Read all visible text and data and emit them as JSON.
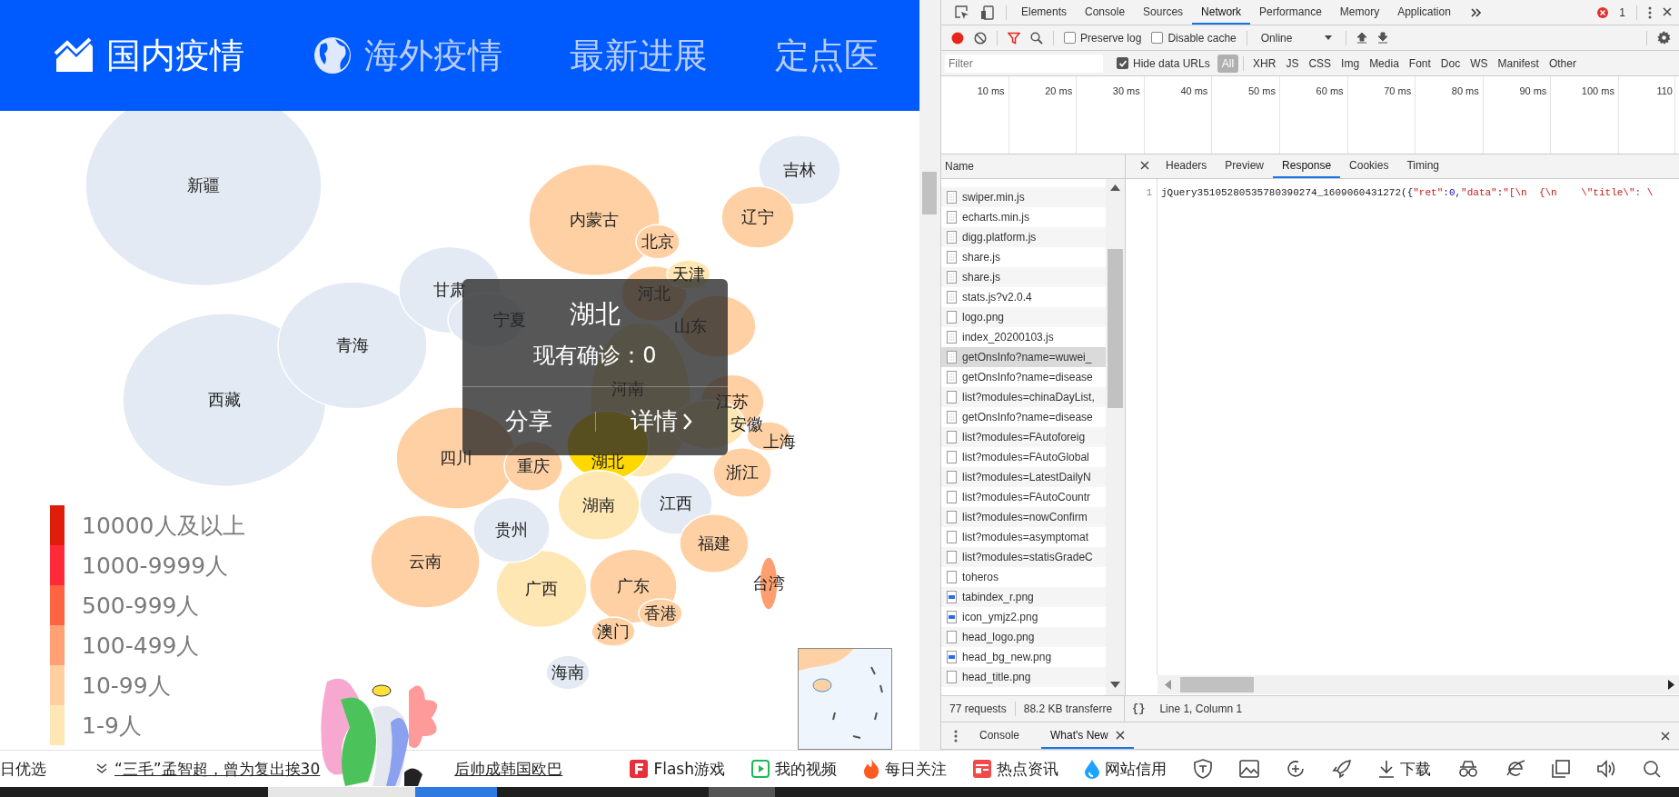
{
  "header": {
    "tabs": [
      {
        "label": "国内疫情",
        "kind": "chart",
        "selected": true
      },
      {
        "label": "海外疫情",
        "kind": "globe",
        "selected": false
      },
      {
        "label": "最新进展",
        "kind": "none",
        "selected": false
      },
      {
        "label": "定点医",
        "kind": "none",
        "selected": false
      }
    ]
  },
  "map": {
    "provinces": [
      {
        "name": "新疆",
        "color": "#e3eaf3"
      },
      {
        "name": "吉林",
        "color": "#e3eaf3"
      },
      {
        "name": "内蒙古",
        "color": "#ffd0a3"
      },
      {
        "name": "辽宁",
        "color": "#ffd0a3"
      },
      {
        "name": "北京",
        "color": "#ffd0a3"
      },
      {
        "name": "甘肃",
        "color": "#e3eaf3"
      },
      {
        "name": "河北",
        "color": "#ffd0a3"
      },
      {
        "name": "天津",
        "color": "#ffe7b3"
      },
      {
        "name": "宁夏",
        "color": "#e3eaf3"
      },
      {
        "name": "山东",
        "color": "#ffd0a3"
      },
      {
        "name": "青海",
        "color": "#e3eaf3"
      },
      {
        "name": "西藏",
        "color": "#e3eaf3"
      },
      {
        "name": "河南",
        "color": "#ffe7b3"
      },
      {
        "name": "江苏",
        "color": "#ffd0a3"
      },
      {
        "name": "安徽",
        "color": "#ffe7b3"
      },
      {
        "name": "上海",
        "color": "#ffd0a3"
      },
      {
        "name": "四川",
        "color": "#ffd0a3"
      },
      {
        "name": "重庆",
        "color": "#ffd0a3"
      },
      {
        "name": "湖北",
        "color": "#ffd800"
      },
      {
        "name": "浙江",
        "color": "#ffd0a3"
      },
      {
        "name": "湖南",
        "color": "#ffe7b3"
      },
      {
        "name": "江西",
        "color": "#e3eaf3"
      },
      {
        "name": "贵州",
        "color": "#e3eaf3"
      },
      {
        "name": "福建",
        "color": "#ffd0a3"
      },
      {
        "name": "云南",
        "color": "#ffd0a3"
      },
      {
        "name": "广西",
        "color": "#ffe7b3"
      },
      {
        "name": "广东",
        "color": "#ffd0a3"
      },
      {
        "name": "台湾",
        "color": "#ff9f6f"
      },
      {
        "name": "香港",
        "color": "#ffd0a3"
      },
      {
        "name": "澳门",
        "color": "#ffd0a3"
      },
      {
        "name": "海南",
        "color": "#e3eaf3"
      }
    ],
    "legend": [
      {
        "label": "10000人及以上",
        "color": "#df1d0a"
      },
      {
        "label": "1000-9999人",
        "color": "#ff2a38"
      },
      {
        "label": "500-999人",
        "color": "#ff6442"
      },
      {
        "label": "100-499人",
        "color": "#ffa075"
      },
      {
        "label": "10-99人",
        "color": "#ffcfa0"
      },
      {
        "label": "1-9人",
        "color": "#ffe7b3"
      }
    ],
    "tooltip": {
      "title": "湖北",
      "text": "现有确诊：0",
      "actions": [
        "分享",
        "详情"
      ]
    }
  },
  "devtools": {
    "panels": [
      {
        "label": "Elements",
        "selected": false
      },
      {
        "label": "Console",
        "selected": false
      },
      {
        "label": "Sources",
        "selected": false
      },
      {
        "label": "Network",
        "selected": true
      },
      {
        "label": "Performance",
        "selected": false
      },
      {
        "label": "Memory",
        "selected": false
      },
      {
        "label": "Application",
        "selected": false
      }
    ],
    "errors": "1",
    "preserve_log": {
      "label": "Preserve log",
      "checked": false
    },
    "disable_cache": {
      "label": "Disable cache",
      "checked": false
    },
    "throttle": "Online",
    "filter_placeholder": "Filter",
    "hide_data_urls": {
      "label": "Hide data URLs",
      "checked": true
    },
    "types": [
      {
        "label": "All",
        "selected": true
      },
      {
        "label": "XHR",
        "selected": false
      },
      {
        "label": "JS",
        "selected": false
      },
      {
        "label": "CSS",
        "selected": false
      },
      {
        "label": "Img",
        "selected": false
      },
      {
        "label": "Media",
        "selected": false
      },
      {
        "label": "Font",
        "selected": false
      },
      {
        "label": "Doc",
        "selected": false
      },
      {
        "label": "WS",
        "selected": false
      },
      {
        "label": "Manifest",
        "selected": false
      },
      {
        "label": "Other",
        "selected": false
      }
    ],
    "timeline_ticks": [
      "10 ms",
      "20 ms",
      "30 ms",
      "40 ms",
      "50 ms",
      "60 ms",
      "70 ms",
      "80 ms",
      "90 ms",
      "100 ms",
      "110"
    ],
    "name_header": "Name",
    "requests": [
      {
        "name": "swiper.min.js",
        "kind": "script",
        "selected": false
      },
      {
        "name": "echarts.min.js",
        "kind": "script",
        "selected": false
      },
      {
        "name": "digg.platform.js",
        "kind": "script",
        "selected": false
      },
      {
        "name": "share.js",
        "kind": "script",
        "selected": false
      },
      {
        "name": "share.js",
        "kind": "script",
        "selected": false
      },
      {
        "name": "stats.js?v2.0.4",
        "kind": "script",
        "selected": false
      },
      {
        "name": "logo.png",
        "kind": "document",
        "selected": false
      },
      {
        "name": "index_20200103.js",
        "kind": "script",
        "selected": false
      },
      {
        "name": "getOnsInfo?name=wuwei_",
        "kind": "script",
        "selected": true
      },
      {
        "name": "getOnsInfo?name=disease",
        "kind": "script",
        "selected": false
      },
      {
        "name": "list?modules=chinaDayList,",
        "kind": "document",
        "selected": false
      },
      {
        "name": "getOnsInfo?name=disease",
        "kind": "script",
        "selected": false
      },
      {
        "name": "list?modules=FAutoforeig",
        "kind": "document",
        "selected": false
      },
      {
        "name": "list?modules=FAutoGlobal",
        "kind": "document",
        "selected": false
      },
      {
        "name": "list?modules=LatestDailyN",
        "kind": "document",
        "selected": false
      },
      {
        "name": "list?modules=FAutoCountr",
        "kind": "document",
        "selected": false
      },
      {
        "name": "list?modules=nowConfirm",
        "kind": "document",
        "selected": false
      },
      {
        "name": "list?modules=asymptomat",
        "kind": "document",
        "selected": false
      },
      {
        "name": "list?modules=statisGradeC",
        "kind": "document",
        "selected": false
      },
      {
        "name": "toheros",
        "kind": "document",
        "selected": false
      },
      {
        "name": "tabindex_r.png",
        "kind": "image",
        "selected": false
      },
      {
        "name": "icon_ymjz2.png",
        "kind": "image",
        "selected": false
      },
      {
        "name": "head_logo.png",
        "kind": "document",
        "selected": false
      },
      {
        "name": "head_bg_new.png",
        "kind": "image",
        "selected": false
      },
      {
        "name": "head_title.png",
        "kind": "document",
        "selected": false
      }
    ],
    "detail_tabs": [
      {
        "label": "Headers",
        "selected": false
      },
      {
        "label": "Preview",
        "selected": false
      },
      {
        "label": "Response",
        "selected": true
      },
      {
        "label": "Cookies",
        "selected": false
      },
      {
        "label": "Timing",
        "selected": false
      }
    ],
    "line_number": "1",
    "response_tokens": [
      {
        "text": "jQuery35105280535780390274_1609060431272({",
        "kind": "plain"
      },
      {
        "text": "\"ret\"",
        "kind": "string"
      },
      {
        "text": ":",
        "kind": "plain"
      },
      {
        "text": "0",
        "kind": "number"
      },
      {
        "text": ",",
        "kind": "plain"
      },
      {
        "text": "\"data\"",
        "kind": "string"
      },
      {
        "text": ":",
        "kind": "plain"
      },
      {
        "text": "\"[\\n  {\\n    \\\"title\\\": \\",
        "kind": "string"
      }
    ],
    "status": {
      "requests": "77 requests",
      "transferred": "88.2 KB transferre",
      "pretty_print": "{}",
      "position": "Line 1, Column 1"
    },
    "drawer_tabs": [
      {
        "label": "Console",
        "selected": false
      },
      {
        "label": "What's New",
        "selected": true
      }
    ]
  },
  "browser_bar": {
    "news": [
      "日优选",
      "“三毛”孟智超，曾为复出挨30",
      "后帅成韩国欧巴"
    ],
    "links": [
      {
        "label": "Flash游戏",
        "kind": "flash"
      },
      {
        "label": "我的视频",
        "kind": "video"
      },
      {
        "label": "每日关注",
        "kind": "fire"
      },
      {
        "label": "热点资讯",
        "kind": "news"
      },
      {
        "label": "网站信用",
        "kind": "credit"
      }
    ],
    "download": "下载"
  }
}
